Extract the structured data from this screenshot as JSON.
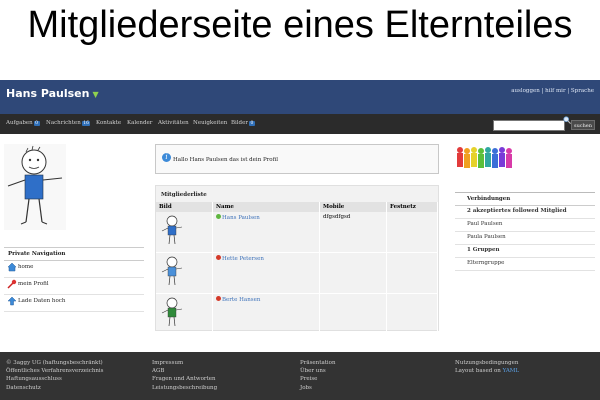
{
  "slide_title": "Mitgliederseite eines Elternteiles",
  "header": {
    "user_name": "Hans Paulsen",
    "links": "ausloggen | hilf mir | Sprache"
  },
  "nav": {
    "items": [
      {
        "label": "Aufgaben",
        "badge": "0"
      },
      {
        "label": "Nachrichten",
        "badge": "16"
      },
      {
        "label": "Kontakte",
        "badge": ""
      },
      {
        "label": "Kalender",
        "badge": ""
      },
      {
        "label": "Aktivitäten",
        "badge": ""
      },
      {
        "label": "Neuigkeiten",
        "badge": ""
      },
      {
        "label": "Bilder",
        "badge": "0"
      }
    ],
    "search_button": "suchen"
  },
  "private_nav": {
    "title": "Private Navigation",
    "items": [
      "home",
      "mein Profil",
      "Lade Daten hoch"
    ]
  },
  "welcome": {
    "message": "Hallo Hans Paulsen das ist dein Profil"
  },
  "members": {
    "caption": "Mitgliederliste",
    "columns": [
      "Bild",
      "Name",
      "Mobile",
      "Festnetz"
    ],
    "rows": [
      {
        "name": "Hans Paulsen",
        "mobile": "dfgsdfgsd",
        "festnetz": "",
        "status": "online",
        "status_color": "#5fb640",
        "shirt_color": "#2f6fc8"
      },
      {
        "name": "Hette Petersen",
        "mobile": "",
        "festnetz": "",
        "status": "offline",
        "status_color": "#d43a2a",
        "shirt_color": "#4a90d9"
      },
      {
        "name": "Berte Hansen",
        "mobile": "",
        "festnetz": "",
        "status": "offline",
        "status_color": "#d43a2a",
        "shirt_color": "#2f8a3a"
      }
    ]
  },
  "connections": {
    "title": "Verbindungen",
    "rows": [
      {
        "text": "2 akzeptiertes followed Mitglied",
        "bold": true
      },
      {
        "text": "Paul Paulsen",
        "bold": false
      },
      {
        "text": "Paula Paulsen",
        "bold": false
      },
      {
        "text": "1 Gruppen",
        "bold": true
      },
      {
        "text": "Elterngruppe",
        "bold": false
      }
    ]
  },
  "footer": {
    "col1": [
      "© 3aggy UG (haftungsbeschränkt)",
      "Öffentliches Verfahrensverzeichnis",
      "Haftungsausschluss",
      "Datenschutz"
    ],
    "col2": [
      "Impressum",
      "AGB",
      "Fragen und Antworten",
      "Leistungsbeschreibung"
    ],
    "col3": [
      "Präsentation",
      "Über uns",
      "Preise",
      "Jobs"
    ],
    "col4_line1": "Nutzungsbedingungen",
    "col4_line2_prefix": "Layout based on ",
    "col4_line2_link": "YAML"
  },
  "colors": {
    "header_bg": "#2f4878",
    "nav_bg": "#2b2b2b",
    "footer_bg": "#333333",
    "link": "#3a6fb8"
  },
  "icons": {
    "home": "home-icon",
    "profile": "pin-icon",
    "upload": "upload-arrow-icon",
    "info": "info-icon",
    "search": "magnifier-icon"
  }
}
